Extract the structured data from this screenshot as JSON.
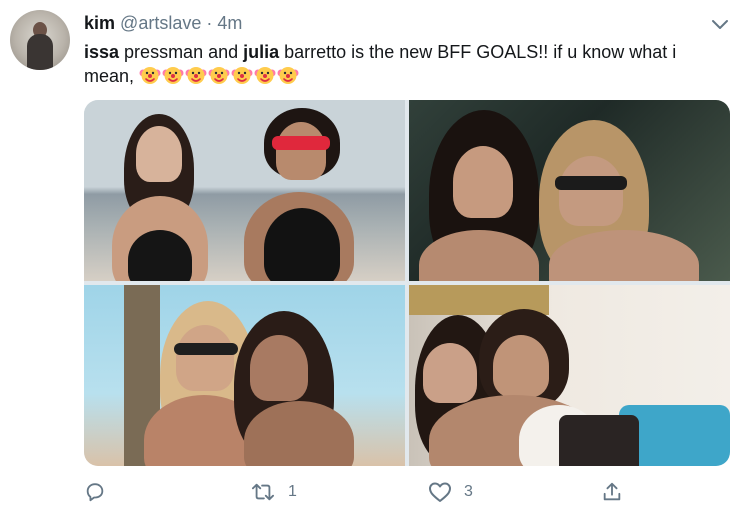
{
  "tweet": {
    "display_name": "kim",
    "handle": "@artslave",
    "separator": "·",
    "time": "4m",
    "text_parts": {
      "part1_bold": "issa",
      "part2": " pressman and ",
      "part3_bold": "julia",
      "part4": " barretto is the new BFF GOALS!! if u know what i mean, "
    },
    "emojis": [
      "clown-face",
      "clown-face",
      "clown-face",
      "clown-face",
      "clown-face",
      "clown-face",
      "clown-face"
    ]
  },
  "actions": {
    "reply_count": "",
    "retweet_count": "1",
    "like_count": "3"
  },
  "colors": {
    "text": "#14171a",
    "secondary": "#657786",
    "clown_face": "#ffcc4d",
    "clown_nose": "#dd2e44",
    "clown_hair": "#ff7aa8"
  }
}
